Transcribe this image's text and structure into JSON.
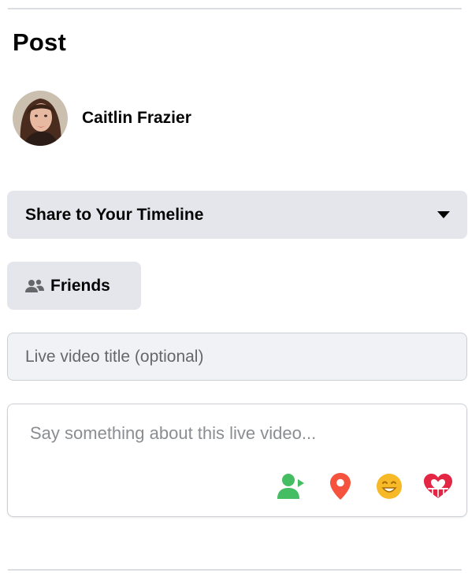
{
  "post": {
    "section_title": "Post",
    "author_name": "Caitlin Frazier"
  },
  "share": {
    "selected": "Share to Your Timeline"
  },
  "audience": {
    "label": "Friends",
    "icon": "friends-icon"
  },
  "live_title": {
    "placeholder": "Live video title (optional)",
    "value": ""
  },
  "description": {
    "placeholder": "Say something about this live video...",
    "value": ""
  },
  "tools": [
    {
      "icon": "tag-people-icon",
      "color": "#45bd62"
    },
    {
      "icon": "location-pin-icon",
      "color": "#f5533d"
    },
    {
      "icon": "feeling-emoji-icon",
      "color": "#f7b928"
    },
    {
      "icon": "support-heart-icon",
      "color": "#e42645"
    }
  ]
}
